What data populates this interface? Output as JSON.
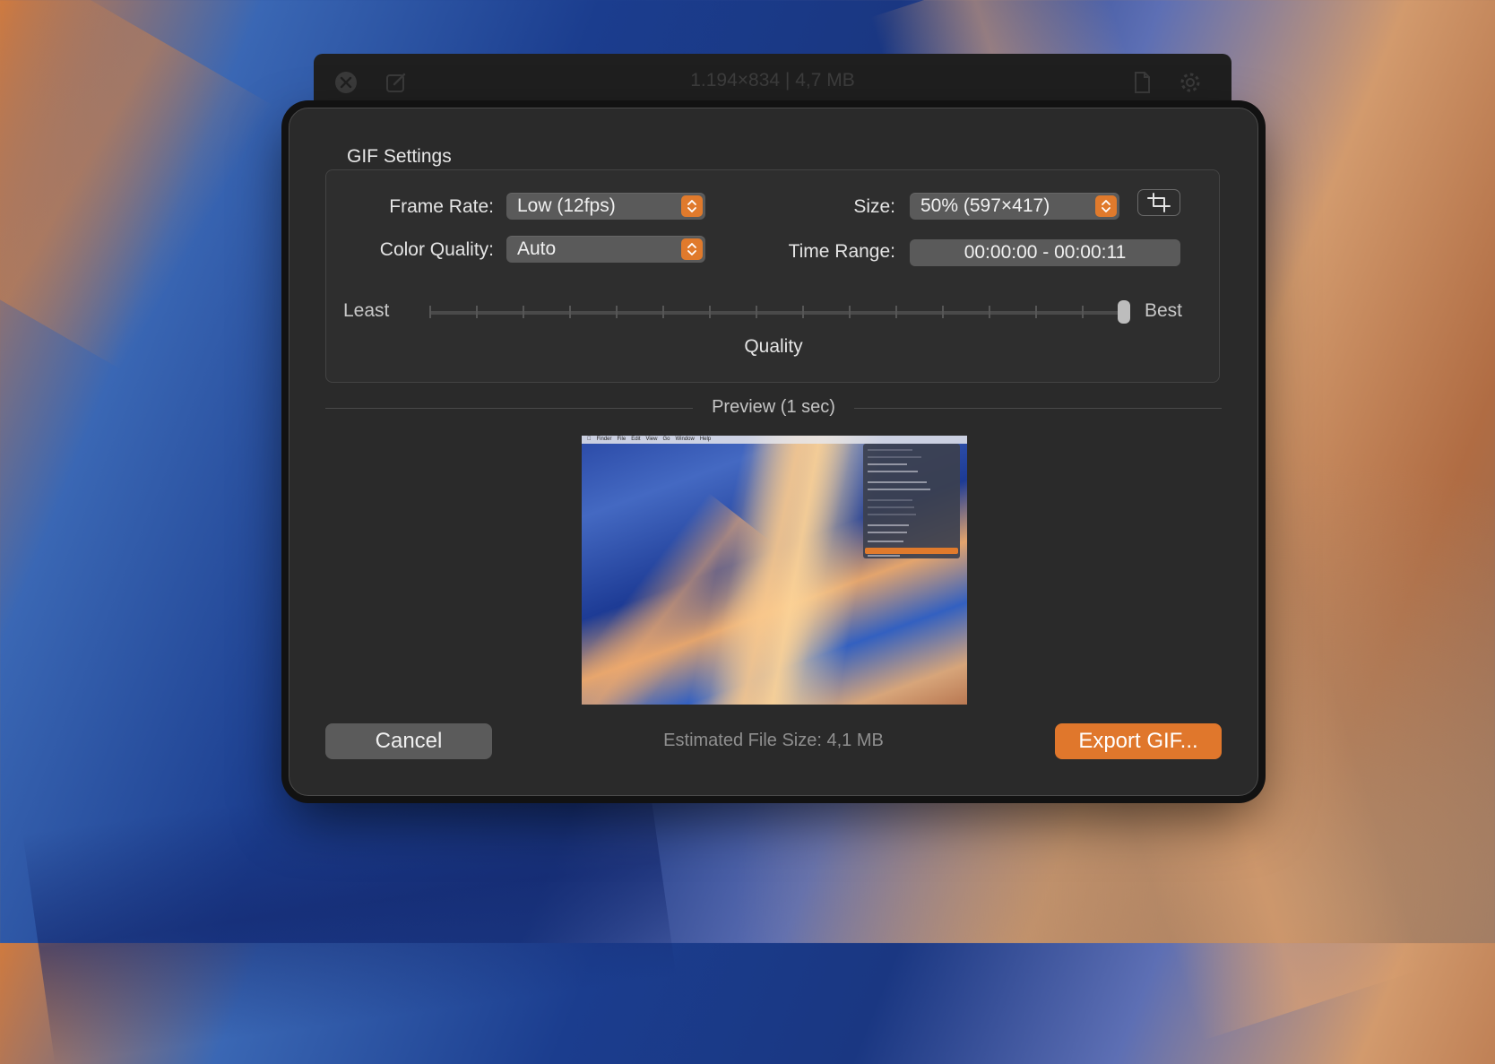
{
  "background_window": {
    "title": "1.194×834 | 4,7 MB"
  },
  "dialog": {
    "section_title": "GIF Settings",
    "frame_rate": {
      "label": "Frame Rate:",
      "value": "Low (12fps)"
    },
    "color_quality": {
      "label": "Color Quality:",
      "value": "Auto"
    },
    "size": {
      "label": "Size:",
      "value": "50% (597×417)"
    },
    "time_range": {
      "label": "Time Range:",
      "value": "00:00:00 - 00:00:11"
    },
    "quality_slider": {
      "min_label": "Least",
      "max_label": "Best",
      "caption": "Quality",
      "level": 1.0
    },
    "preview": {
      "title": "Preview (1 sec)"
    },
    "estimated_size": "Estimated File Size: 4,1 MB",
    "cancel_label": "Cancel",
    "export_label": "Export GIF..."
  },
  "icons": {
    "close": "close-icon",
    "edit": "edit-icon",
    "document": "document-icon",
    "settings": "gear-icon",
    "crop": "crop-icon",
    "stepper": "chevron-up-down-icon"
  },
  "colors": {
    "accent": "#e0772c",
    "dialog_bg": "#2a2a2a",
    "control_bg": "#5a5a5a"
  }
}
